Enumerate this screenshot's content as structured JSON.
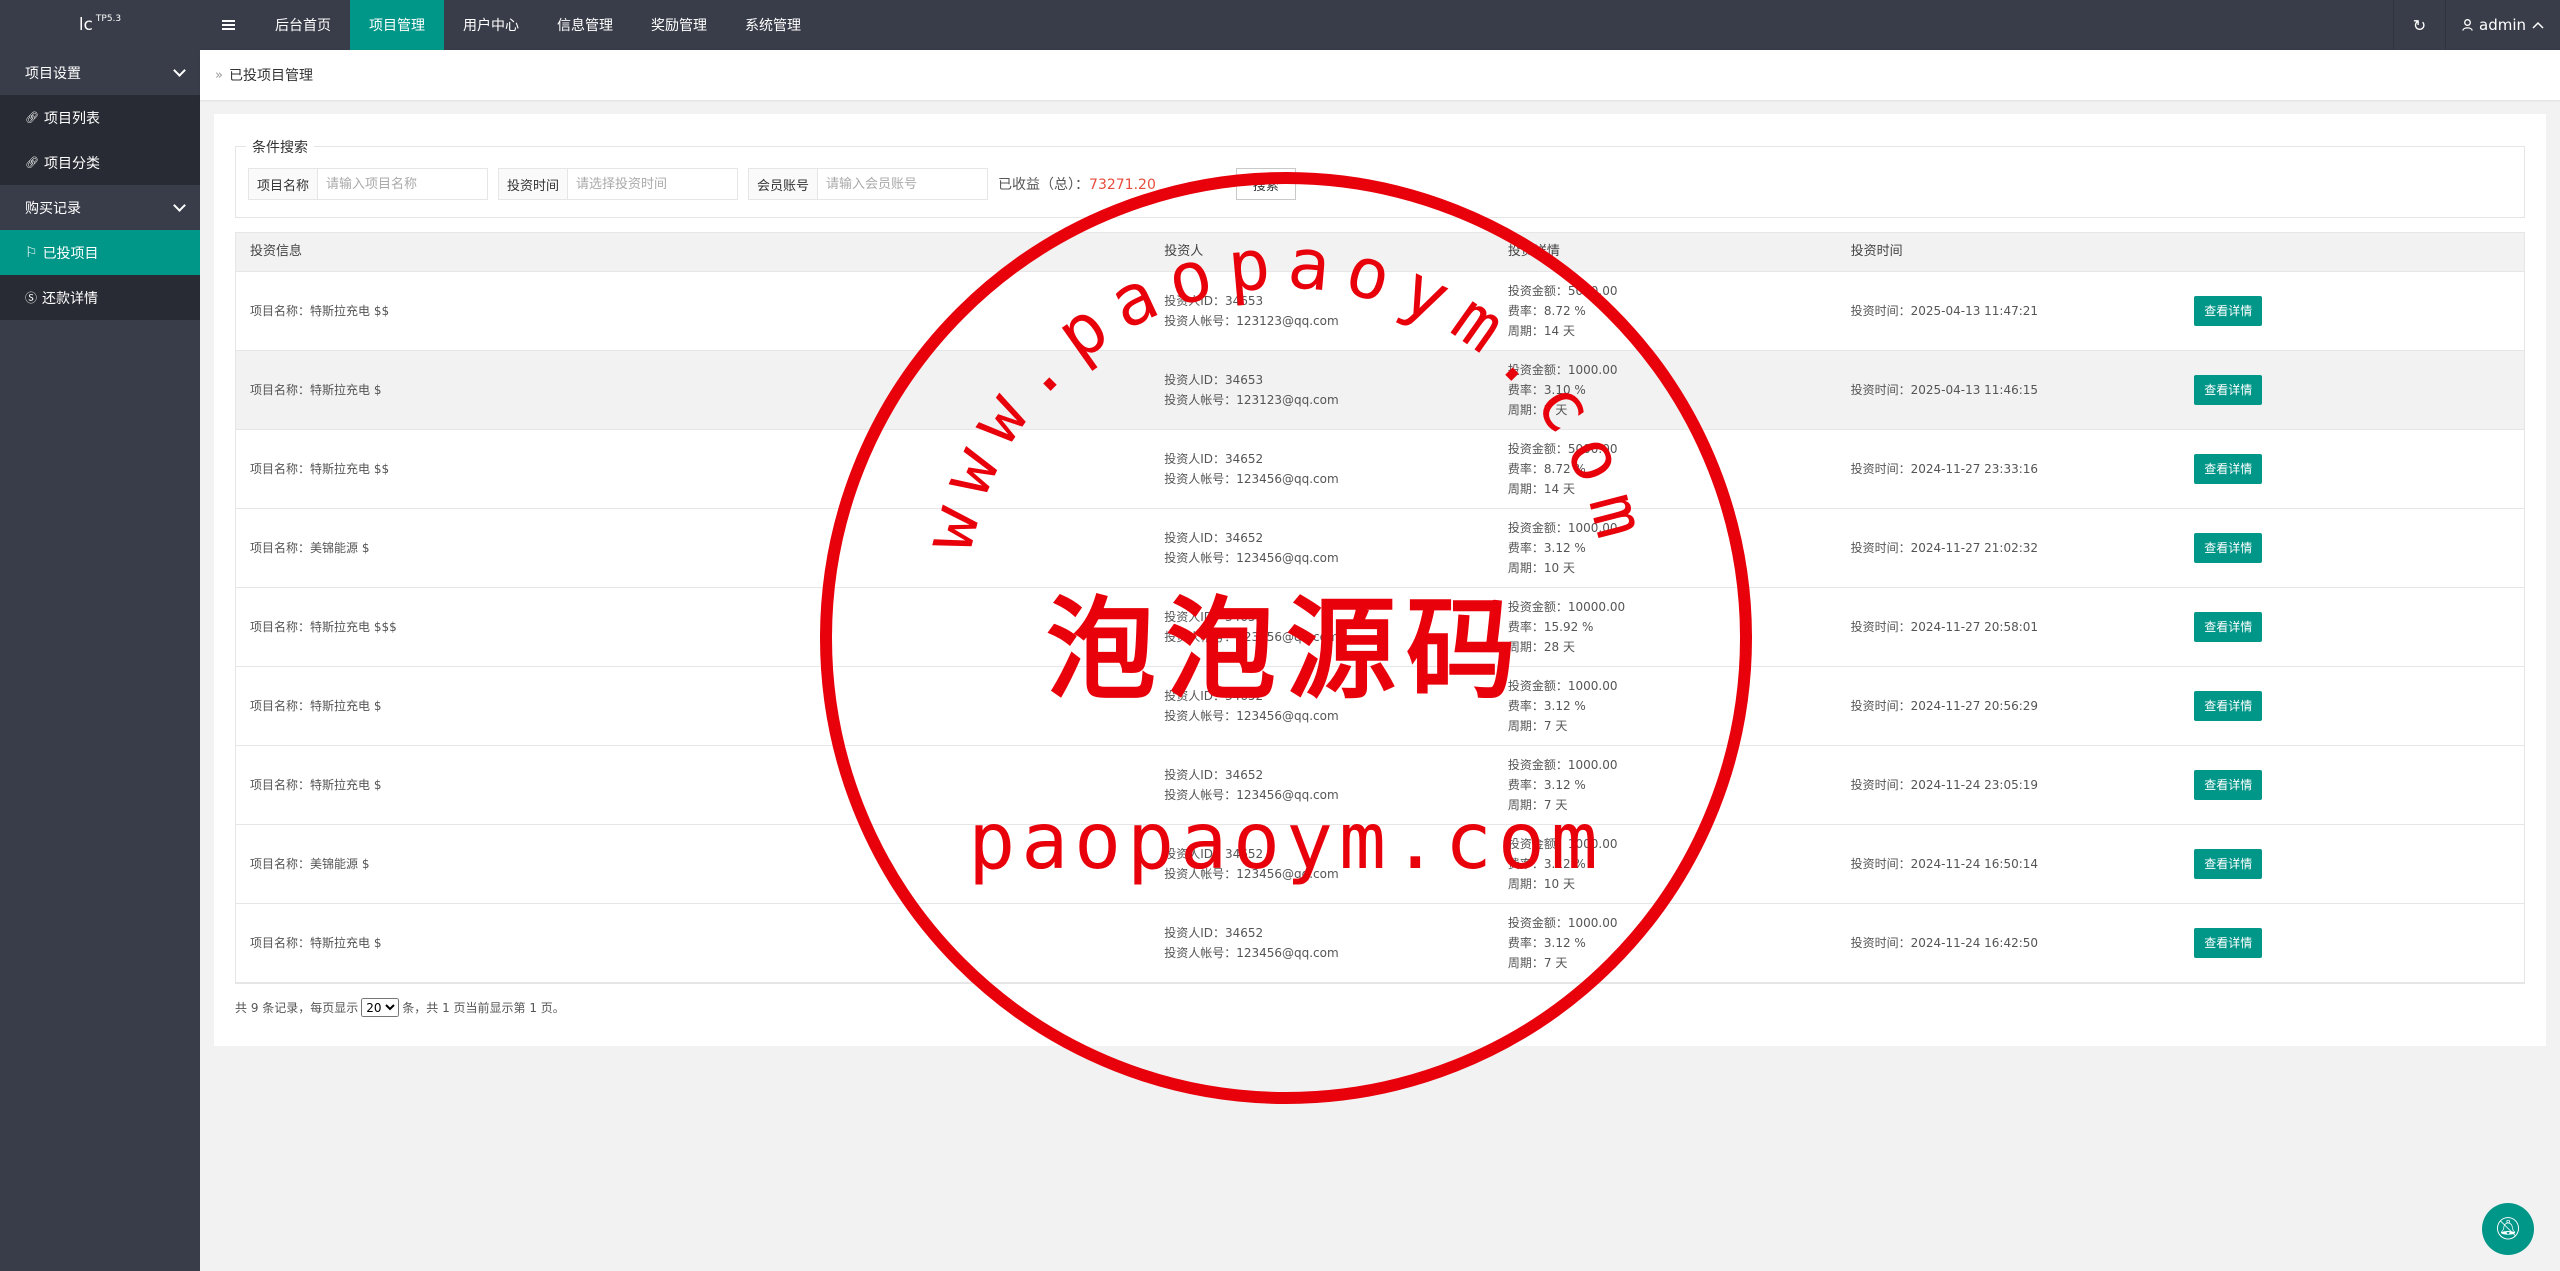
{
  "app": {
    "logo": "lc",
    "version": "TP5.3"
  },
  "topnav": {
    "items": [
      {
        "label": "后台首页"
      },
      {
        "label": "项目管理"
      },
      {
        "label": "用户中心"
      },
      {
        "label": "信息管理"
      },
      {
        "label": "奖励管理"
      },
      {
        "label": "系统管理"
      }
    ],
    "active_index": 1,
    "user": "admin"
  },
  "sidebar": {
    "groups": [
      {
        "label": "项目设置",
        "items": [
          {
            "label": "项目列表"
          },
          {
            "label": "项目分类"
          }
        ]
      },
      {
        "label": "购买记录",
        "items": [
          {
            "label": "已投项目"
          },
          {
            "label": "还款详情"
          }
        ]
      }
    ],
    "active": "已投项目"
  },
  "breadcrumb": {
    "current": "已投项目管理"
  },
  "search": {
    "legend": "条件搜索",
    "project_name_label": "项目名称",
    "project_name_placeholder": "请输入项目名称",
    "invest_time_label": "投资时间",
    "invest_time_placeholder": "请选择投资时间",
    "member_label": "会员账号",
    "member_placeholder": "请输入会员账号",
    "earnings_label": "已收益（总）：",
    "earnings_value": "73271.20",
    "search_button": "搜索"
  },
  "table": {
    "headers": [
      "投资信息",
      "投资人",
      "投资详情",
      "投资时间",
      ""
    ],
    "rows": [
      {
        "name": "项目名称：特斯拉充电 $$",
        "uid": "投资人ID：34653",
        "account": "投资人帐号：123123@qq.com",
        "amount": "投资金额：5000.00",
        "rate": "费率：8.72 %",
        "period": "周期：14 天",
        "time": "投资时间：2025-04-13 11:47:21",
        "action": "查看详情"
      },
      {
        "name": "项目名称：特斯拉充电 $",
        "uid": "投资人ID：34653",
        "account": "投资人帐号：123123@qq.com",
        "amount": "投资金额：1000.00",
        "rate": "费率：3.10 %",
        "period": "周期：7 天",
        "time": "投资时间：2025-04-13 11:46:15",
        "action": "查看详情"
      },
      {
        "name": "项目名称：特斯拉充电 $$",
        "uid": "投资人ID：34652",
        "account": "投资人帐号：123456@qq.com",
        "amount": "投资金额：5000.00",
        "rate": "费率：8.72 %",
        "period": "周期：14 天",
        "time": "投资时间：2024-11-27 23:33:16",
        "action": "查看详情"
      },
      {
        "name": "项目名称：美锦能源 $",
        "uid": "投资人ID：34652",
        "account": "投资人帐号：123456@qq.com",
        "amount": "投资金额：1000.00",
        "rate": "费率：3.12 %",
        "period": "周期：10 天",
        "time": "投资时间：2024-11-27 21:02:32",
        "action": "查看详情"
      },
      {
        "name": "项目名称：特斯拉充电 $$$",
        "uid": "投资人ID：34652",
        "account": "投资人帐号：123456@qq.com",
        "amount": "投资金额：10000.00",
        "rate": "费率：15.92 %",
        "period": "周期：28 天",
        "time": "投资时间：2024-11-27 20:58:01",
        "action": "查看详情"
      },
      {
        "name": "项目名称：特斯拉充电 $",
        "uid": "投资人ID：34652",
        "account": "投资人帐号：123456@qq.com",
        "amount": "投资金额：1000.00",
        "rate": "费率：3.12 %",
        "period": "周期：7 天",
        "time": "投资时间：2024-11-27 20:56:29",
        "action": "查看详情"
      },
      {
        "name": "项目名称：特斯拉充电 $",
        "uid": "投资人ID：34652",
        "account": "投资人帐号：123456@qq.com",
        "amount": "投资金额：1000.00",
        "rate": "费率：3.12 %",
        "period": "周期：7 天",
        "time": "投资时间：2024-11-24 23:05:19",
        "action": "查看详情"
      },
      {
        "name": "项目名称：美锦能源 $",
        "uid": "投资人ID：34652",
        "account": "投资人帐号：123456@qq.com",
        "amount": "投资金额：1000.00",
        "rate": "费率：3.12 %",
        "period": "周期：10 天",
        "time": "投资时间：2024-11-24 16:50:14",
        "action": "查看详情"
      },
      {
        "name": "项目名称：特斯拉充电 $",
        "uid": "投资人ID：34652",
        "account": "投资人帐号：123456@qq.com",
        "amount": "投资金额：1000.00",
        "rate": "费率：3.12 %",
        "period": "周期：7 天",
        "time": "投资时间：2024-11-24 16:42:50",
        "action": "查看详情"
      }
    ]
  },
  "pager": {
    "prefix": "共 9 条记录，每页显示",
    "page_size": "20",
    "suffix": "条，共 1 页当前显示第 1 页。"
  },
  "watermark": {
    "arc_text": "www.paopaoym.com",
    "center_text": "泡泡源码",
    "bottom_text": "paopaoym.com",
    "color": "#e8000b"
  },
  "colors": {
    "accent": "#009688",
    "dark": "#393d49",
    "earnings": "#e74c3c"
  }
}
